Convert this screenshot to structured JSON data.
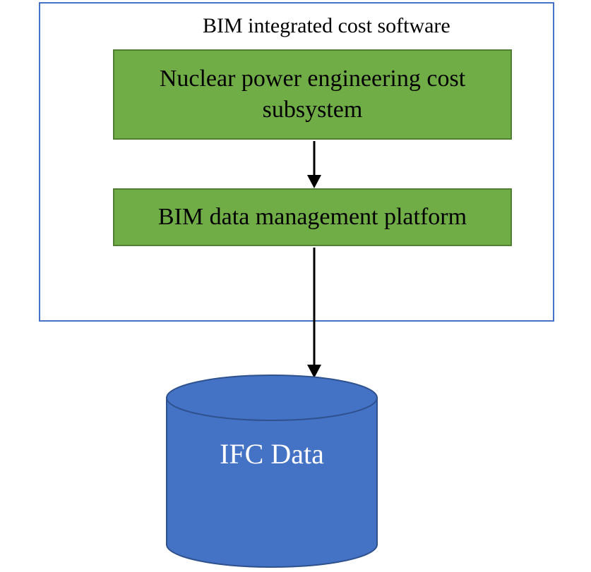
{
  "diagram": {
    "container_title": "BIM integrated cost software",
    "box1_label": "Nuclear power engineering cost subsystem",
    "box2_label": "BIM data management platform",
    "cylinder_label": "IFC Data",
    "colors": {
      "frame_border": "#4472C4",
      "box_fill": "#70AD47",
      "box_border": "#507E32",
      "cylinder_fill": "#4472C4",
      "cylinder_border": "#2F528F",
      "arrow": "#000000"
    }
  }
}
